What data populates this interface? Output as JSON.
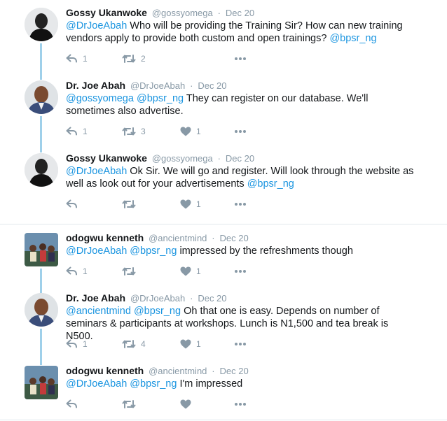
{
  "colors": {
    "link": "#1b95e0",
    "meta": "#8899a6",
    "text": "#14171a",
    "connector": "#9fd0ea",
    "divider": "#e1e8ed"
  },
  "icons": {
    "reply": "reply-arrow-icon",
    "retweet": "retweet-icon",
    "like": "heart-icon",
    "more": "more-dots-icon"
  },
  "tweets": [
    {
      "name": "Gossy Ukanwoke",
      "handle": "@gossyomega",
      "sep": "·",
      "date": "Dec 20",
      "mention1": "@DrJoeAbah",
      "body1": " Who will be providing the Training Sir? How can new training vendors apply to provide both custom and open trainings? ",
      "mention2": "@bpsr_ng",
      "body2": "",
      "replies": "1",
      "retweets": "2",
      "likes": ""
    },
    {
      "name": "Dr. Joe Abah",
      "handle": "@DrJoeAbah",
      "sep": "·",
      "date": "Dec 20",
      "mention1": "@gossyomega",
      "body1": " ",
      "mention2": "@bpsr_ng",
      "body2": " They can register on our database. We'll sometimes also advertise.",
      "replies": "1",
      "retweets": "3",
      "likes": "1"
    },
    {
      "name": "Gossy Ukanwoke",
      "handle": "@gossyomega",
      "sep": "·",
      "date": "Dec 20",
      "mention1": "@DrJoeAbah",
      "body1": " Ok Sir. We will go and register. Will look through the website as well as look out for your advertisements ",
      "mention2": "@bpsr_ng",
      "body2": "",
      "replies": "",
      "retweets": "",
      "likes": "1"
    },
    {
      "name": "odogwu kenneth",
      "handle": "@ancientmind",
      "sep": "·",
      "date": "Dec 20",
      "mention1": "@DrJoeAbah",
      "body1": " ",
      "mention2": "@bpsr_ng",
      "body2": " impressed by the refreshments though",
      "replies": "1",
      "retweets": "",
      "likes": "1"
    },
    {
      "name": "Dr. Joe Abah",
      "handle": "@DrJoeAbah",
      "sep": "·",
      "date": "Dec 20",
      "mention1": "@ancientmind",
      "body1": " ",
      "mention2": "@bpsr_ng",
      "body2": " Oh that one is easy. Depends on number of seminars & participants at workshops. Lunch is N1,500 and tea break is N500.",
      "replies": "1",
      "retweets": "4",
      "likes": "1"
    },
    {
      "name": "odogwu kenneth",
      "handle": "@ancientmind",
      "sep": "·",
      "date": "Dec 20",
      "mention1": "@DrJoeAbah",
      "body1": " ",
      "mention2": "@bpsr_ng",
      "body2": " I'm impressed",
      "replies": "",
      "retweets": "",
      "likes": ""
    }
  ]
}
